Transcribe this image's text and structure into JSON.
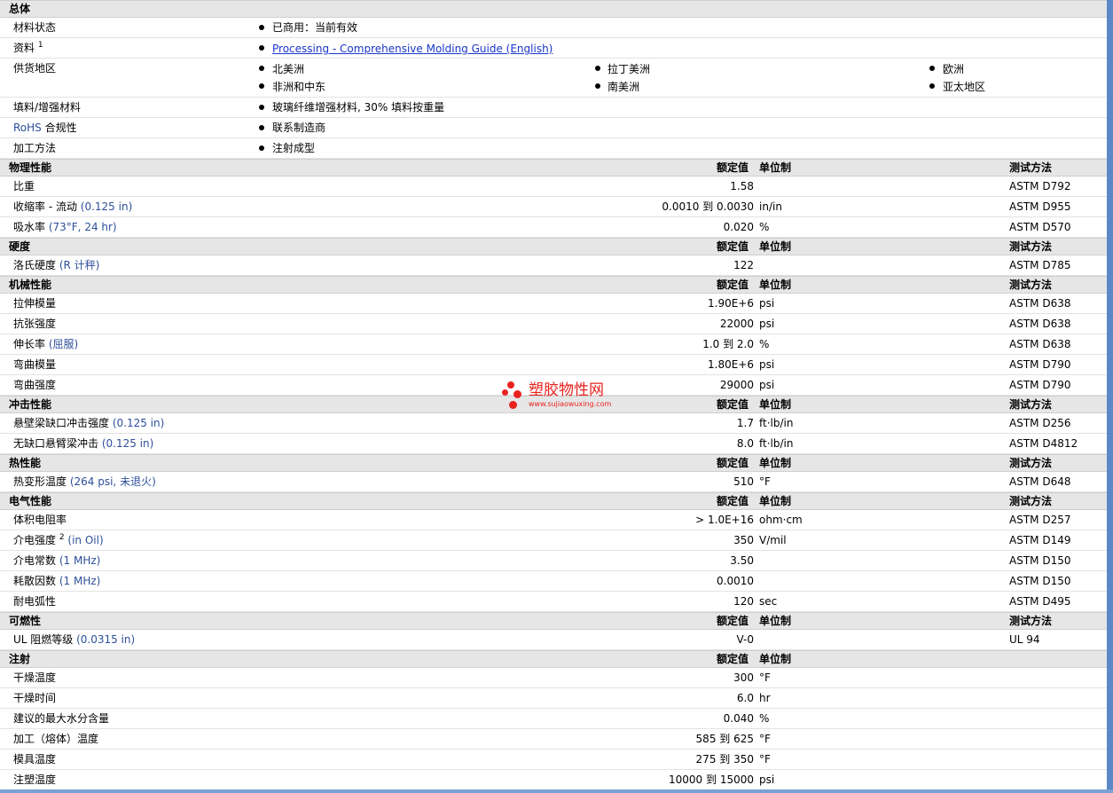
{
  "headers": {
    "value": "额定值",
    "unit": "单位制",
    "method": "测试方法"
  },
  "general": {
    "title": "总体",
    "material_status": {
      "label": "材料状态",
      "value": "已商用：当前有效"
    },
    "datasheet": {
      "label": "资料",
      "sup": "1",
      "link": "Processing - Comprehensive Molding Guide (English)"
    },
    "regions": {
      "label": "供货地区",
      "items": [
        "北美洲",
        "拉丁美洲",
        "欧洲",
        "非洲和中东",
        "南美洲",
        "亚太地区"
      ]
    },
    "filler": {
      "label": "填料/增强材料",
      "value": "玻璃纤维增强材料, 30% 填料按重量"
    },
    "rohs": {
      "label_blue": "RoHS",
      "label_rest": " 合规性",
      "value": "联系制造商"
    },
    "processing": {
      "label": "加工方法",
      "value": "注射成型"
    }
  },
  "physical": {
    "title": "物理性能",
    "rows": [
      {
        "name": "比重",
        "cond": "",
        "value": "1.58",
        "unit": "",
        "method": "ASTM D792"
      },
      {
        "name": "收缩率 - 流动",
        "cond": " (0.125 in)",
        "value": "0.0010 到  0.0030",
        "unit": "in/in",
        "method": "ASTM D955"
      },
      {
        "name": "吸水率",
        "cond": " (73°F, 24 hr)",
        "value": "0.020",
        "unit": "%",
        "method": "ASTM D570"
      }
    ]
  },
  "hardness": {
    "title": "硬度",
    "rows": [
      {
        "name": "洛氏硬度",
        "cond": " (R 计秤)",
        "value": "122",
        "unit": "",
        "method": "ASTM D785"
      }
    ]
  },
  "mechanical": {
    "title": "机械性能",
    "rows": [
      {
        "name": "拉伸模量",
        "cond": "",
        "value": "1.90E+6",
        "unit": "psi",
        "method": "ASTM D638"
      },
      {
        "name": "抗张强度",
        "cond": "",
        "value": "22000",
        "unit": "psi",
        "method": "ASTM D638"
      },
      {
        "name": "伸长率",
        "cond": " (屈服)",
        "value": "1.0 到  2.0",
        "unit": "%",
        "method": "ASTM D638"
      },
      {
        "name": "弯曲模量",
        "cond": "",
        "value": "1.80E+6",
        "unit": "psi",
        "method": "ASTM D790"
      },
      {
        "name": "弯曲强度",
        "cond": "",
        "value": "29000",
        "unit": "psi",
        "method": "ASTM D790"
      }
    ]
  },
  "impact": {
    "title": "冲击性能",
    "rows": [
      {
        "name": "悬壁梁缺口冲击强度",
        "cond": " (0.125 in)",
        "value": "1.7",
        "unit": "ft·lb/in",
        "method": "ASTM D256"
      },
      {
        "name": "无缺口悬臂梁冲击",
        "cond": " (0.125 in)",
        "value": "8.0",
        "unit": "ft·lb/in",
        "method": "ASTM D4812"
      }
    ]
  },
  "thermal": {
    "title": "热性能",
    "rows": [
      {
        "name": "热变形温度",
        "cond": " (264 psi, 未退火)",
        "value": "510",
        "unit": "°F",
        "method": "ASTM D648"
      }
    ]
  },
  "electrical": {
    "title": "电气性能",
    "rows": [
      {
        "name": "体积电阻率",
        "cond": "",
        "value": "> 1.0E+16",
        "unit": "ohm·cm",
        "method": "ASTM D257"
      },
      {
        "name": "介电强度",
        "sup": "2",
        "cond": " (in Oil)",
        "value": "350",
        "unit": "V/mil",
        "method": "ASTM D149"
      },
      {
        "name": "介电常数",
        "cond": " (1 MHz)",
        "value": "3.50",
        "unit": "",
        "method": "ASTM D150"
      },
      {
        "name": "耗散因数",
        "cond": " (1 MHz)",
        "value": "0.0010",
        "unit": "",
        "method": "ASTM D150"
      },
      {
        "name": "耐电弧性",
        "cond": "",
        "value": "120",
        "unit": "sec",
        "method": "ASTM D495"
      }
    ]
  },
  "flammability": {
    "title": "可燃性",
    "rows": [
      {
        "name": "UL 阻燃等级",
        "cond": " (0.0315 in)",
        "value": "V-0",
        "unit": "",
        "method": "UL 94"
      }
    ]
  },
  "injection": {
    "title": "注射",
    "rows": [
      {
        "name": "干燥温度",
        "cond": "",
        "value": "300",
        "unit": "°F",
        "method": ""
      },
      {
        "name": "干燥时间",
        "cond": "",
        "value": "6.0",
        "unit": "hr",
        "method": ""
      },
      {
        "name": "建议的最大水分含量",
        "cond": "",
        "value": "0.040",
        "unit": "%",
        "method": ""
      },
      {
        "name": "加工（熔体）温度",
        "cond": "",
        "value": "585 到  625",
        "unit": "°F",
        "method": ""
      },
      {
        "name": "模具温度",
        "cond": "",
        "value": "275 到  350",
        "unit": "°F",
        "method": ""
      },
      {
        "name": "注塑温度",
        "cond": "",
        "value": "10000 到  15000",
        "unit": "psi",
        "method": ""
      }
    ]
  },
  "watermark": {
    "name": "塑胶物性网",
    "url": "www.sujiaowuxing.com"
  },
  "colors": {
    "header_bg": "#e6e6e6",
    "link": "#1a36c8",
    "condition": "#2e4f9a",
    "watermark": "#e8231e",
    "scrollbar": "#5a88c8"
  }
}
